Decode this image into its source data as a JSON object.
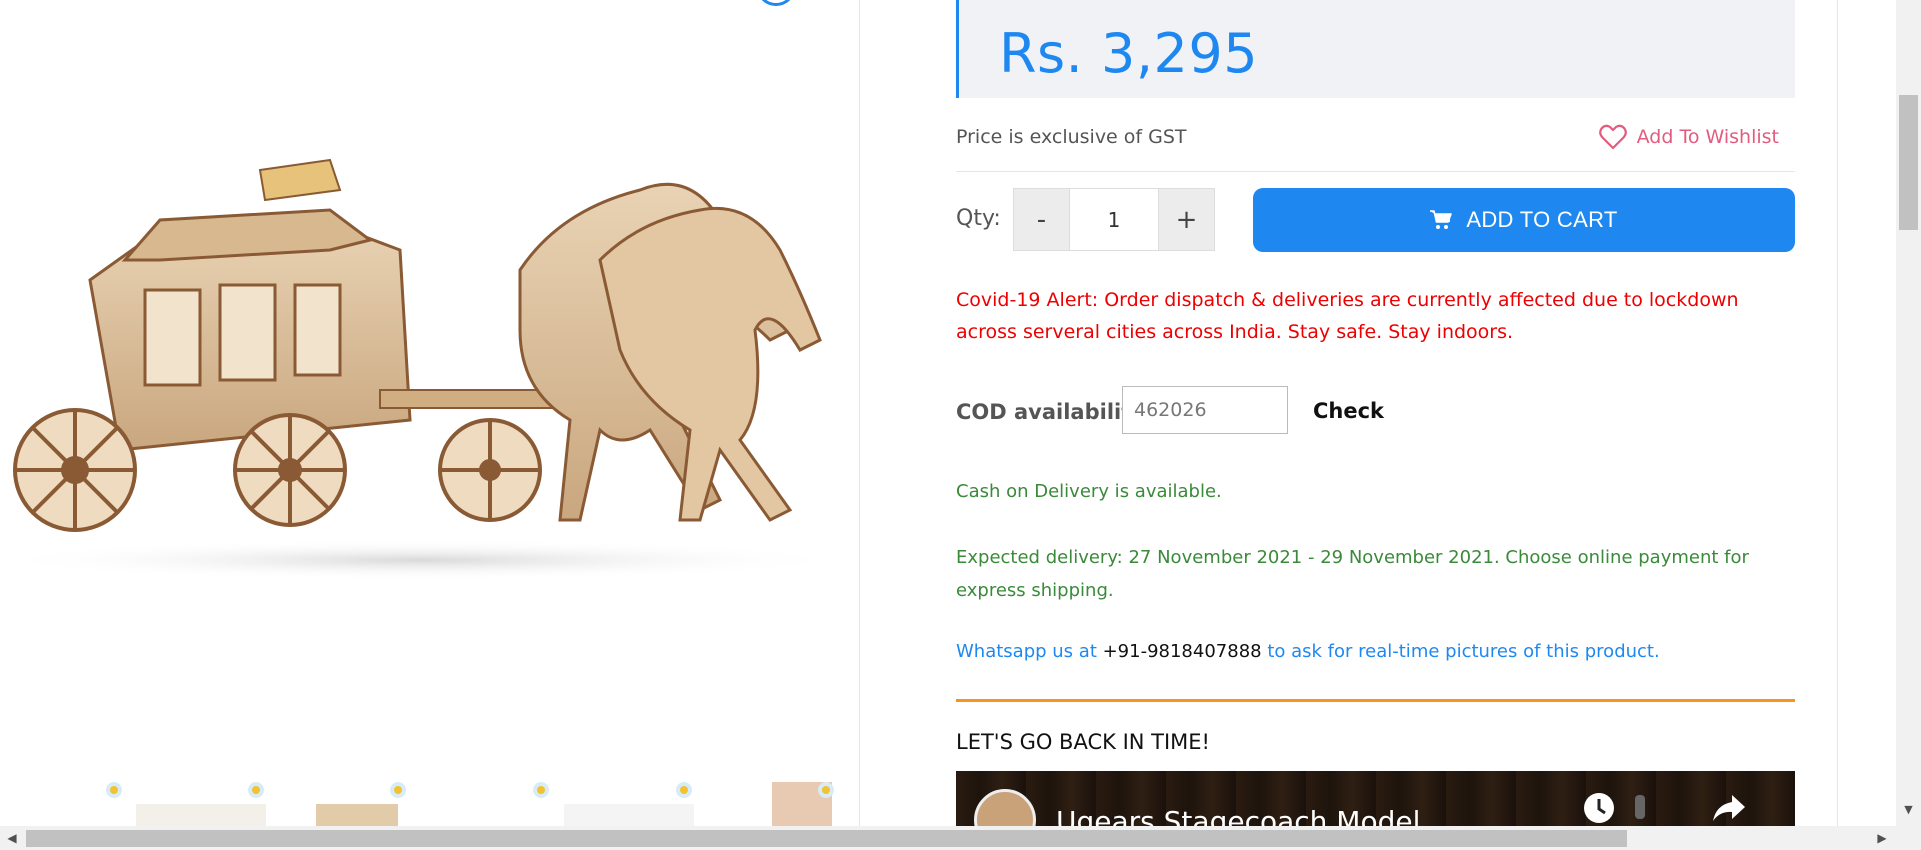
{
  "product": {
    "price": "Rs. 3,295",
    "gst_note": "Price is exclusive of GST",
    "wishlist_label": "Add To Wishlist",
    "qty_label": "Qty:",
    "qty_minus": "-",
    "qty_value": "1",
    "qty_plus": "+",
    "add_to_cart_label": "ADD TO CART"
  },
  "alert": {
    "text": "Covid-19 Alert: Order dispatch & deliveries are currently affected due to lockdown across serveral cities across India. Stay safe. Stay indoors."
  },
  "cod": {
    "label": "COD availability",
    "pincode_value": "462026",
    "check_label": "Check",
    "status": "Cash on Delivery is available.",
    "expected_delivery": "Expected delivery: 27 November 2021 - 29 November 2021. Choose online payment for express shipping."
  },
  "whatsapp": {
    "prefix": "Whatsapp us at ",
    "number": "+91-9818407888",
    "suffix": " to ask for real-time pictures of this product."
  },
  "section": {
    "heading": "LET'S GO BACK IN TIME!"
  },
  "video": {
    "title": "Ugears Stagecoach Model"
  },
  "colors": {
    "accent": "#1e88f0",
    "alert_red": "#ee0000",
    "success_green": "#3a8a3a",
    "wishlist_pink": "#e35b7e",
    "divider_orange": "#f7941d"
  },
  "icons": {
    "wishlist": "heart-icon",
    "cart": "cart-icon",
    "watch_later": "clock-icon",
    "share": "share-icon"
  },
  "scrollbars": {
    "up_arrow": "▲",
    "down_arrow": "▼",
    "left_arrow": "◀",
    "right_arrow": "▶"
  }
}
